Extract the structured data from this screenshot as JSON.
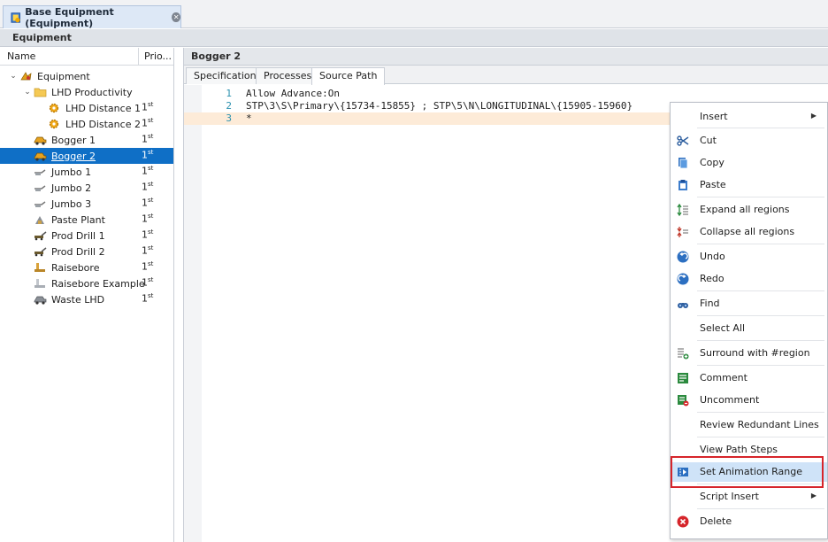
{
  "document_tab": {
    "title": "Base Equipment (Equipment)"
  },
  "panel": {
    "title": "Equipment"
  },
  "tree": {
    "columns": {
      "name": "Name",
      "priority": "Prio..."
    },
    "rows": [
      {
        "label": "Equipment",
        "priority": "",
        "icon": "equipment-root-icon"
      },
      {
        "label": "LHD Productivity",
        "priority": "",
        "icon": "folder-icon"
      },
      {
        "label": "LHD Distance 1",
        "priority": "1",
        "priority_suffix": "st",
        "icon": "gear-icon"
      },
      {
        "label": "LHD Distance 2",
        "priority": "1",
        "priority_suffix": "st",
        "icon": "gear-icon"
      },
      {
        "label": "Bogger 1",
        "priority": "1",
        "priority_suffix": "st",
        "icon": "loader-icon"
      },
      {
        "label": "Bogger 2",
        "priority": "1",
        "priority_suffix": "st",
        "icon": "loader-icon"
      },
      {
        "label": "Jumbo 1",
        "priority": "1",
        "priority_suffix": "st",
        "icon": "jumbo-drill-icon"
      },
      {
        "label": "Jumbo 2",
        "priority": "1",
        "priority_suffix": "st",
        "icon": "jumbo-drill-icon"
      },
      {
        "label": "Jumbo 3",
        "priority": "1",
        "priority_suffix": "st",
        "icon": "jumbo-drill-icon"
      },
      {
        "label": "Paste Plant",
        "priority": "1",
        "priority_suffix": "st",
        "icon": "plant-icon"
      },
      {
        "label": "Prod Drill 1",
        "priority": "1",
        "priority_suffix": "st",
        "icon": "prod-drill-icon"
      },
      {
        "label": "Prod Drill 2",
        "priority": "1",
        "priority_suffix": "st",
        "icon": "prod-drill-icon"
      },
      {
        "label": "Raisebore",
        "priority": "1",
        "priority_suffix": "st",
        "icon": "raisebore-icon"
      },
      {
        "label": "Raisebore Example",
        "priority": "1",
        "priority_suffix": "st",
        "icon": "raisebore-icon"
      },
      {
        "label": "Waste LHD",
        "priority": "1",
        "priority_suffix": "st",
        "icon": "loader-icon"
      }
    ]
  },
  "editor": {
    "title": "Bogger 2",
    "tabs": [
      {
        "label": "Specifications"
      },
      {
        "label": "Processes"
      },
      {
        "label": "Source Path",
        "active": true
      }
    ],
    "lines": [
      {
        "num": "1",
        "text": "Allow Advance:On"
      },
      {
        "num": "2",
        "text": "STP\\3\\S\\Primary\\{15734-15855} ; STP\\5\\N\\LONGITUDINAL\\{15905-15960}"
      },
      {
        "num": "3",
        "text": "*"
      }
    ]
  },
  "context_menu": {
    "items": [
      {
        "label": "Insert",
        "submenu": true
      },
      {
        "label": "Cut",
        "icon": "scissors-icon"
      },
      {
        "label": "Copy",
        "icon": "copy-icon"
      },
      {
        "label": "Paste",
        "icon": "paste-icon"
      },
      {
        "label": "Expand all regions",
        "icon": "expand-regions-icon"
      },
      {
        "label": "Collapse all regions",
        "icon": "collapse-regions-icon"
      },
      {
        "label": "Undo",
        "icon": "undo-icon"
      },
      {
        "label": "Redo",
        "icon": "redo-icon"
      },
      {
        "label": "Find",
        "icon": "binoculars-icon"
      },
      {
        "label": "Select All"
      },
      {
        "label": "Surround with #region",
        "icon": "surround-region-icon"
      },
      {
        "label": "Comment",
        "icon": "comment-icon"
      },
      {
        "label": "Uncomment",
        "icon": "uncomment-icon"
      },
      {
        "label": "Review Redundant Lines"
      },
      {
        "label": "View Path Steps"
      },
      {
        "label": "Set Animation Range",
        "icon": "animation-range-icon",
        "highlighted": true
      },
      {
        "label": "Script Insert",
        "submenu": true
      },
      {
        "label": "Delete",
        "icon": "delete-icon"
      }
    ]
  },
  "colors": {
    "selection": "#0f6fc6",
    "highlight_frame": "#d6252b",
    "menu_hover": "#cfe3f8",
    "line_number": "#2b91af",
    "keyword": "#b0207a"
  }
}
